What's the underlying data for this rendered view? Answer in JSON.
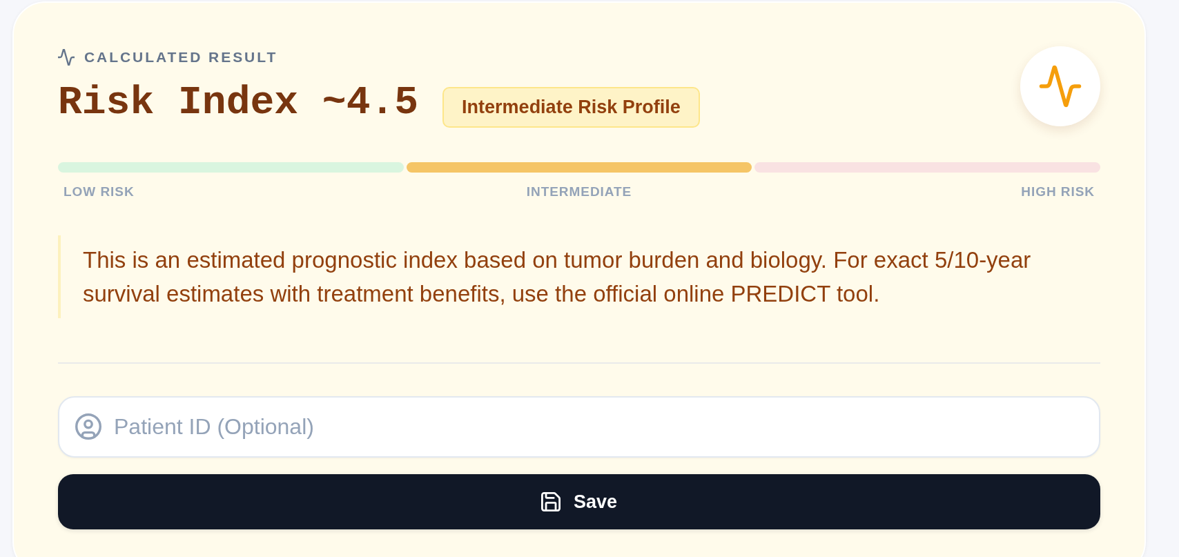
{
  "result": {
    "label": "CALCULATED RESULT",
    "title": "Risk Index ~4.5",
    "badge": "Intermediate Risk Profile"
  },
  "risk_scale": {
    "segments": [
      {
        "label": "LOW RISK",
        "color": "#d9f5df"
      },
      {
        "label": "INTERMEDIATE",
        "color": "#f5c566"
      },
      {
        "label": "HIGH RISK",
        "color": "#f9e2e2"
      }
    ]
  },
  "note": "This is an estimated prognostic index based on tumor burden and biology. For exact 5/10-year survival estimates with treatment benefits, use the official online PREDICT tool.",
  "patient_id": {
    "placeholder": "Patient ID (Optional)"
  },
  "save_button": {
    "label": "Save"
  }
}
